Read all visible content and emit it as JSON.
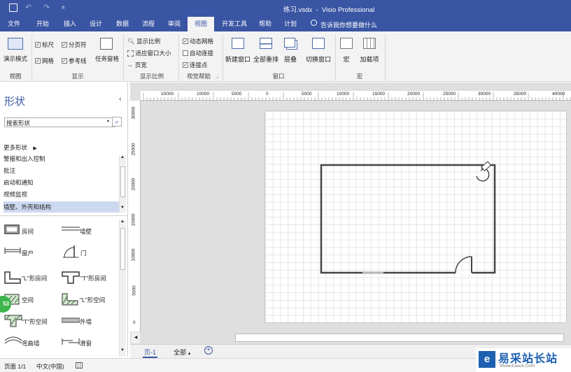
{
  "app": {
    "window_title": "练习.vsdx  -  Visio Professional",
    "qat_icons": [
      "save-icon",
      "undo-icon",
      "redo-icon",
      "customize-icon"
    ]
  },
  "tabs": [
    "文件",
    "开始",
    "插入",
    "设计",
    "数据",
    "流程",
    "审阅",
    "视图",
    "开发工具",
    "帮助",
    "计划"
  ],
  "active_tab": "视图",
  "tell_me": "告诉我你想要做什么",
  "ribbon": {
    "present_mode": "演示模式",
    "group_view": "视图",
    "ruler": "标尺",
    "page_break": "分页符",
    "grid": "网格",
    "guides": "参考线",
    "task_panes": "任务窗格",
    "group_show": "显示",
    "zoom": "显示比例",
    "fit_window": "适应窗口大小",
    "page_width": "页宽",
    "group_zoom": "显示比例",
    "dynamic_grid": "动态网格",
    "autoconnect": "自动连接",
    "connection_points": "连接点",
    "group_visual_aids": "视觉帮助",
    "new_window": "新建窗口",
    "arrange_all": "全部重排",
    "cascade": "层叠",
    "switch_windows": "切换窗口",
    "group_window": "窗口",
    "macros": "宏",
    "addins": "加载项",
    "group_macros": "宏"
  },
  "shapes_panel": {
    "title": "形状",
    "search_placeholder": "搜索形状",
    "more_shapes": "更多形状",
    "stencils": [
      "警报和出入控制",
      "批注",
      "启动和通知",
      "视频监视",
      "墙壁、外壳和结构"
    ],
    "selected_stencil": "墙壁、外壳和结构",
    "shapes": [
      "房间",
      "墙壁",
      "窗户",
      "门",
      "\"L\"形房间",
      "\"T\"形房间",
      "空间",
      "\"L\"形空间",
      "\"T\"形空间",
      "外墙",
      "弯曲墙",
      "滑窗"
    ]
  },
  "ruler": {
    "h_ticks": [
      "15000",
      "10000",
      "5000",
      "0",
      "5000",
      "10000",
      "15000",
      "20000",
      "25000",
      "30000",
      "35000",
      "40000"
    ],
    "v_ticks": [
      "30000",
      "25000",
      "20000",
      "15000",
      "10000",
      "5000",
      "0"
    ]
  },
  "page_tabs": {
    "current": "页-1",
    "all": "全部",
    "add_icon": "plus-icon"
  },
  "status": {
    "page": "页面 1/1",
    "language": "中文(中国)"
  },
  "badge": "53",
  "watermark": {
    "name": "易采站长站",
    "url": "Www.Easck.Com"
  },
  "colors": {
    "brand": "#3955a3",
    "selected_stencil_bg": "#cdd9f1"
  }
}
